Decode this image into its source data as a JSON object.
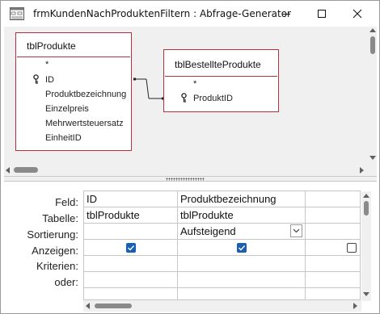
{
  "window": {
    "title": "frmKundenNachProduktenFiltern : Abfrage-Generator",
    "icon": "query-window-icon",
    "controls": [
      "minimize-icon",
      "maximize-icon",
      "close-icon"
    ]
  },
  "tables": [
    {
      "name": "tblProdukte",
      "fields": [
        {
          "label": "*",
          "key": false
        },
        {
          "label": "ID",
          "key": true
        },
        {
          "label": "Produktbezeichnung",
          "key": false
        },
        {
          "label": "Einzelpreis",
          "key": false
        },
        {
          "label": "Mehrwertsteuersatz",
          "key": false
        },
        {
          "label": "EinheitID",
          "key": false
        }
      ]
    },
    {
      "name": "tblBestellteProdukte",
      "fields": [
        {
          "label": "*",
          "key": false
        },
        {
          "label": "ProduktID",
          "key": true
        }
      ]
    }
  ],
  "grid": {
    "row_labels": {
      "field": "Feld:",
      "table": "Tabelle:",
      "sort": "Sortierung:",
      "show": "Anzeigen:",
      "criteria": "Kriterien:",
      "or": "oder:"
    },
    "columns": [
      {
        "field": "ID",
        "table": "tblProdukte",
        "sort": "",
        "show": true
      },
      {
        "field": "Produktbezeichnung",
        "table": "tblProdukte",
        "sort": "Aufsteigend",
        "show": true
      },
      {
        "field": "",
        "table": "",
        "sort": "",
        "show": false
      }
    ]
  },
  "colors": {
    "table_border": "#b5323c",
    "checkbox_checked": "#1a5fb4",
    "pane_background": "#f0f0f0"
  }
}
